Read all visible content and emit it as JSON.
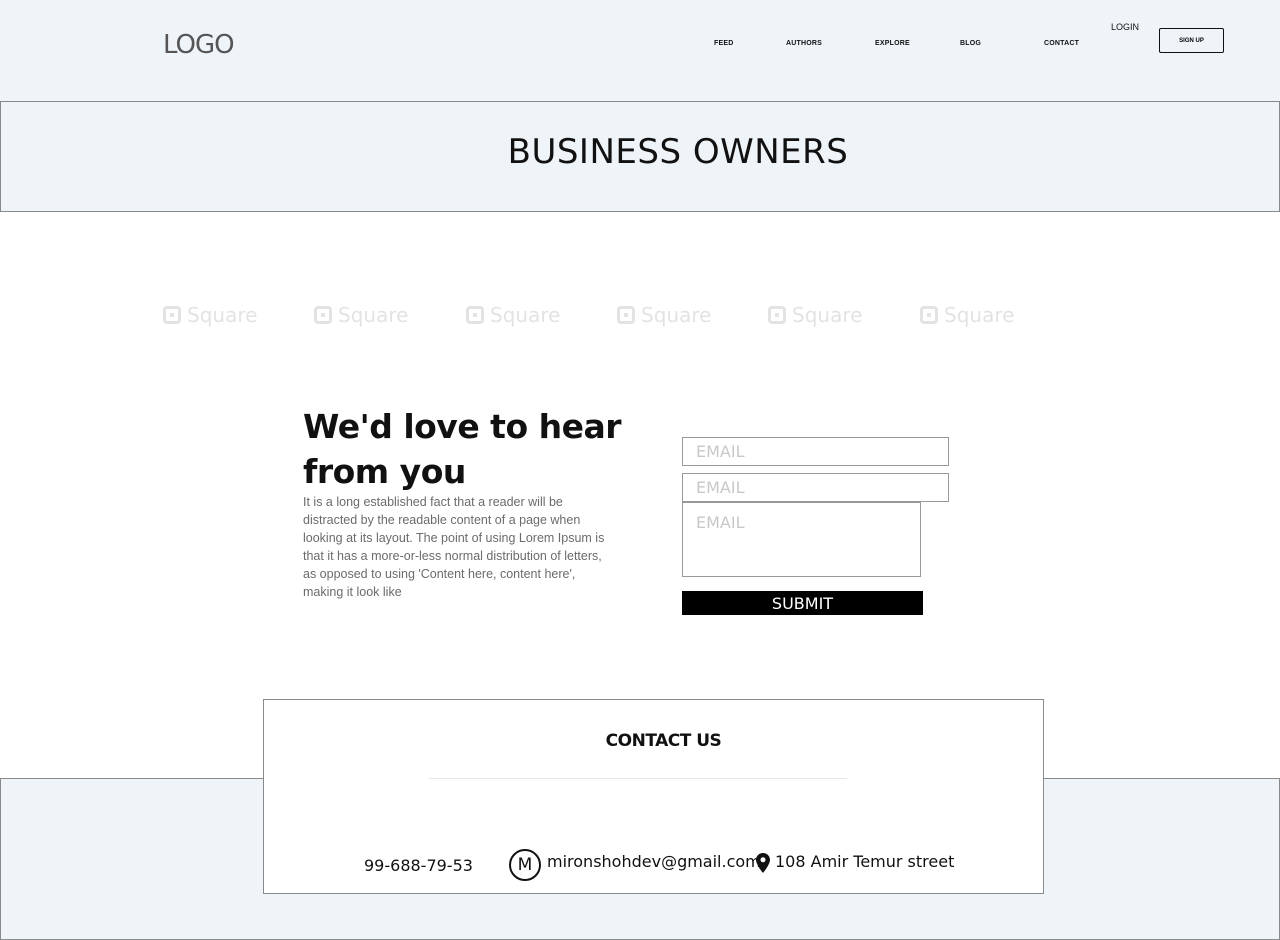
{
  "header": {
    "logo": "LOGO",
    "nav": [
      "FEED",
      "AUTHORS",
      "EXPLORE",
      "BLOG",
      "CONTACT"
    ],
    "login": "LOGIN",
    "signup": "SIGN UP"
  },
  "banner": {
    "title": "BUSINESS OWNERS"
  },
  "partners": [
    "Square",
    "Square",
    "Square",
    "Square",
    "Square",
    "Square"
  ],
  "contact_form": {
    "title": "We'd love to hear from you",
    "body": "It is a long established fact that a reader will be distracted by the readable content of a page when looking at its layout. The point of using Lorem Ipsum is that it has a more-or-less normal distribution of letters, as opposed to using 'Content here, content here', making it look like",
    "field1_placeholder": "EMAIL",
    "field2_placeholder": "EMAIL",
    "field3_placeholder": "EMAIL",
    "submit": "SUBMIT"
  },
  "contact_us": {
    "title": "CONTACT US",
    "phone": "99-688-79-53",
    "mail_icon": "M",
    "email": "mironshohdev@gmail.com",
    "address": "108 Amir Temur street"
  }
}
